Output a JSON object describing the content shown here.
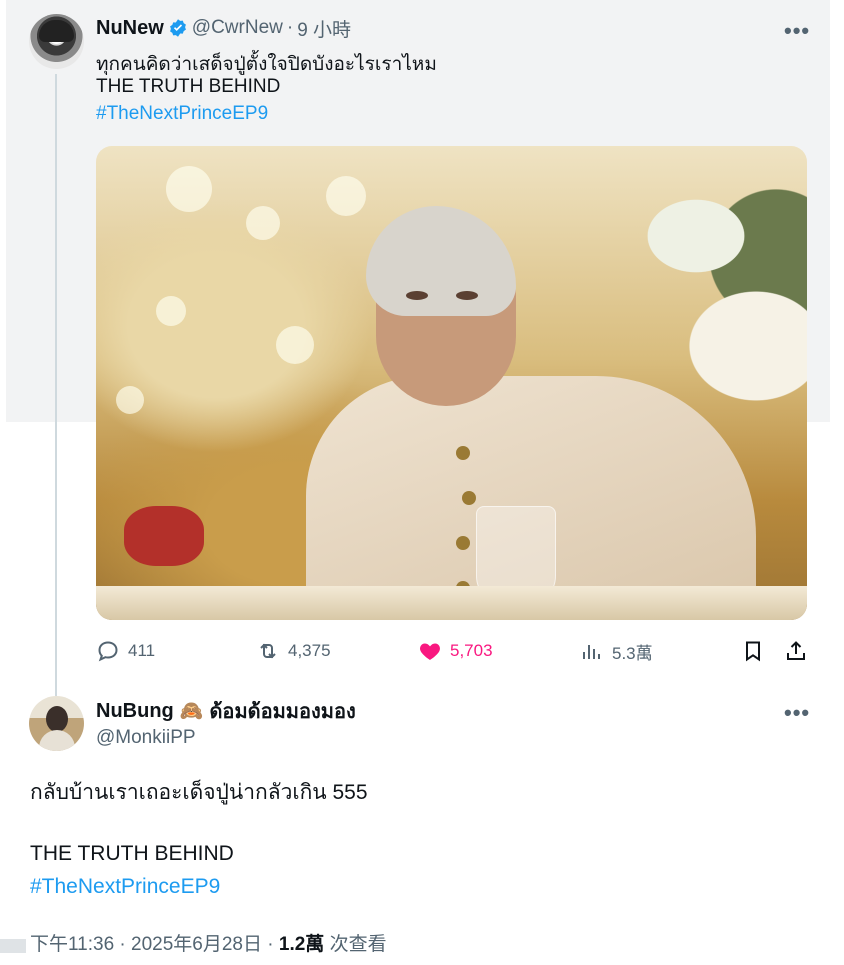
{
  "colors": {
    "accent": "#1d9bf0",
    "like": "#f91880",
    "muted": "#536471",
    "text": "#0f1419"
  },
  "tweet": {
    "author_name": "NuNew",
    "verified_icon": "verified-badge-icon",
    "handle": "@CwrNew",
    "separator": "·",
    "time": "9 小時",
    "more_icon": "more-icon",
    "lines": [
      "ทุกคนคิดว่าเสด็จปู่ตั้งใจปิดบังอะไรเราไหม",
      "THE TRUTH BEHIND",
      "#TheNextPrinceEP9"
    ],
    "actions": {
      "reply_icon": "reply-icon",
      "replies": "411",
      "retweet_icon": "retweet-icon",
      "retweets": "4,375",
      "like_icon": "heart-icon",
      "likes": "5,703",
      "views_icon": "views-icon",
      "views": "5.3萬",
      "bookmark_icon": "bookmark-icon",
      "share_icon": "share-icon"
    }
  },
  "reply": {
    "author_name": "NuBung",
    "emoji": "🙈",
    "author_suffix": "ด้อมด้อมมองมอง",
    "handle": "@MonkiiPP",
    "more_icon": "more-icon",
    "lines": [
      "กลับบ้านเราเถอะเด็จปู่น่ากลัวเกิน 555",
      "THE TRUTH BEHIND",
      "#TheNextPrinceEP9"
    ],
    "meta": {
      "timestamp": "下午11:36 · 2025年6月28日 · ",
      "views_count": "1.2萬",
      "views_label": " 次查看"
    }
  }
}
